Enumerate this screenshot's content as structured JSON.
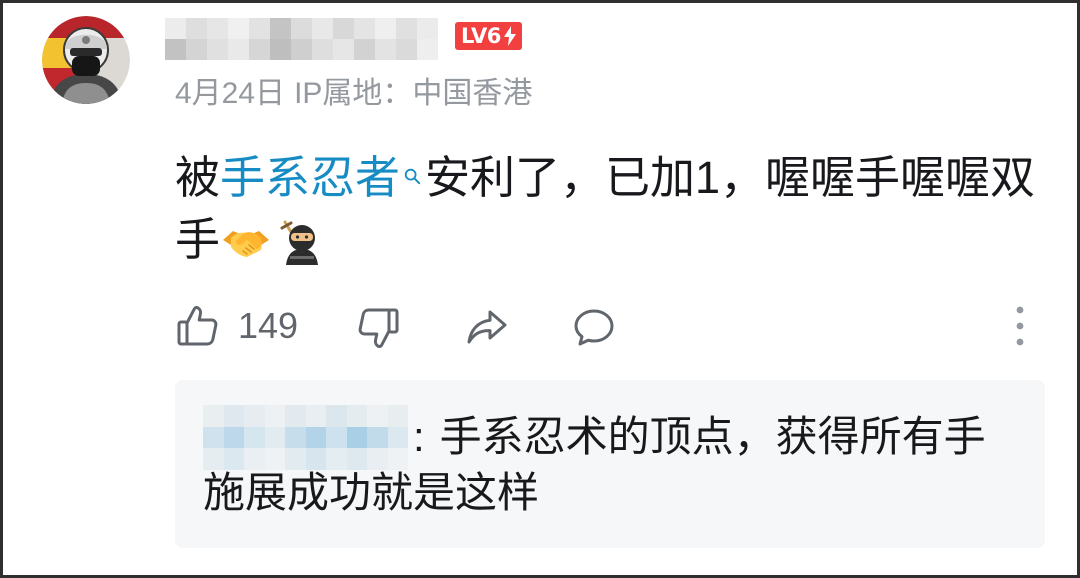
{
  "comment": {
    "author": {
      "avatar": "avatar-image",
      "level": "LV6",
      "level_icon": "lightning-icon"
    },
    "date": "4月24日",
    "ip_location": "IP属地：中国香港",
    "content": {
      "prefix": "被",
      "link": "手系忍者",
      "link_icon": "search-icon",
      "rest": "安利了，已加1，喔喔手喔喔双手",
      "emojis": [
        "handshake-emoji-icon",
        "ninja-emoji-icon"
      ]
    },
    "actions": {
      "like_icon": "thumbs-up-icon",
      "like_count": "149",
      "dislike_icon": "thumbs-down-icon",
      "share_icon": "share-icon",
      "reply_icon": "comment-icon",
      "more_icon": "more-vertical-icon"
    }
  },
  "reply_preview": {
    "separator": ":",
    "text": "手系忍术的顶点，获得所有手施展成功就是这样"
  },
  "colors": {
    "link": "#178bc4",
    "level_badge": "#f23f3f",
    "secondary_text": "#9499a0",
    "icon": "#61666d",
    "reply_background": "#f6f7f8"
  }
}
